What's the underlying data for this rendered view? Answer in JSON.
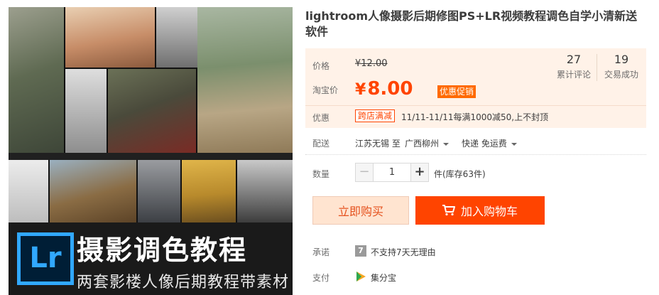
{
  "product": {
    "title": "lightroom人像摄影后期修图PS+LR视频教程调色自学小清新送软件"
  },
  "gallery": {
    "logo_text": "Lr",
    "banner_title": "摄影调色教程",
    "banner_subtitle": "两套影楼人像后期教程带素材"
  },
  "price": {
    "label": "价格",
    "original": "¥12.00",
    "sale_label": "淘宝价",
    "sale_currency": "¥",
    "sale_value": "8.00",
    "promo_tag": "优惠促销",
    "reviews_count": "27",
    "reviews_label": "累计评论",
    "sales_count": "19",
    "sales_label": "交易成功"
  },
  "discount": {
    "label": "优惠",
    "tag": "跨店满减",
    "description": "11/11-11/11每满1000减50,上不封顶"
  },
  "shipping": {
    "label": "配送",
    "from": "江苏无锡 至",
    "to": "广西柳州",
    "method": "快递 免运费"
  },
  "quantity": {
    "label": "数量",
    "minus": "−",
    "value": "1",
    "plus": "+",
    "stock": "件(库存63件)"
  },
  "actions": {
    "buy_now": "立即购买",
    "add_to_cart": "加入购物车"
  },
  "promise": {
    "label": "承诺",
    "icon_text": "7",
    "text": "不支持7天无理由"
  },
  "payment": {
    "label": "支付",
    "text": "集分宝"
  },
  "colors": {
    "accent": "#ff4400",
    "price_bg": "#fff2e8",
    "buy_now_bg": "#ffe4d0"
  }
}
